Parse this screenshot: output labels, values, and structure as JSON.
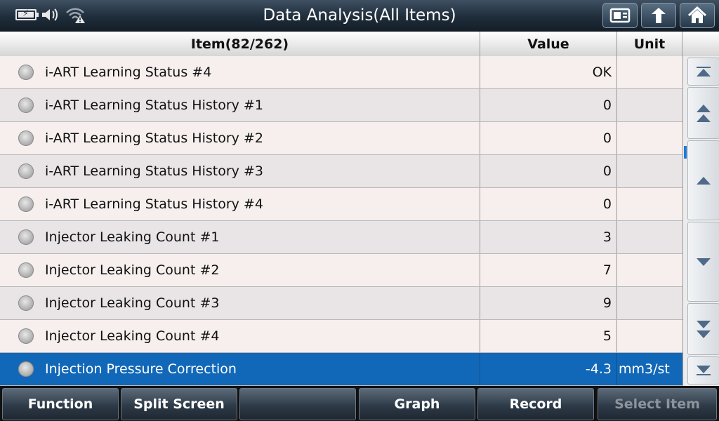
{
  "header": {
    "title": "Data Analysis(All Items)",
    "icons": [
      "battery-icon",
      "speaker-icon",
      "wifi-warning-icon",
      "screenshot-icon",
      "back-icon",
      "home-icon"
    ]
  },
  "table": {
    "columns": {
      "item": "Item(82/262)",
      "value": "Value",
      "unit": "Unit"
    },
    "rows": [
      {
        "name": "i-ART Learning Status #4",
        "value": "OK",
        "unit": ""
      },
      {
        "name": "i-ART Learning Status History #1",
        "value": "0",
        "unit": ""
      },
      {
        "name": "i-ART Learning Status History #2",
        "value": "0",
        "unit": ""
      },
      {
        "name": "i-ART Learning Status History #3",
        "value": "0",
        "unit": ""
      },
      {
        "name": "i-ART Learning Status History #4",
        "value": "0",
        "unit": ""
      },
      {
        "name": "Injector Leaking Count #1",
        "value": "3",
        "unit": ""
      },
      {
        "name": "Injector Leaking Count #2",
        "value": "7",
        "unit": ""
      },
      {
        "name": "Injector Leaking Count #3",
        "value": "9",
        "unit": ""
      },
      {
        "name": "Injector Leaking Count #4",
        "value": "5",
        "unit": ""
      },
      {
        "name": "Injection Pressure Correction",
        "value": "-4.3",
        "unit": "mm3/st"
      }
    ]
  },
  "toolbar": {
    "function": "Function",
    "split_screen": "Split Screen",
    "empty": "",
    "graph": "Graph",
    "record": "Record",
    "select_item": "Select Item"
  },
  "colors": {
    "selected_row": "#1268b8",
    "header_bar": "#1f2d3b"
  }
}
